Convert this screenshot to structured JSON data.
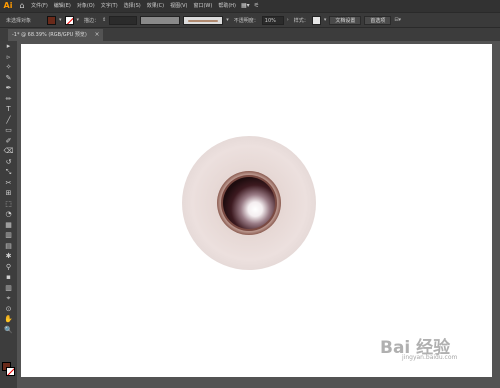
{
  "app": {
    "logo": "Ai",
    "home_icon": "home-icon"
  },
  "menu": [
    "文件(F)",
    "编辑(E)",
    "对象(O)",
    "文字(T)",
    "选择(S)",
    "效果(C)",
    "视图(V)",
    "窗口(W)",
    "帮助(H)"
  ],
  "menu_extra": {
    "workspace_glyph": "▦▾",
    "icon": "arrange-icon"
  },
  "control": {
    "no_selection": "未选择对象",
    "stroke_label": "描边：",
    "stroke_value": "",
    "opacity_label": "不透明度：",
    "opacity_value": "10%",
    "style_label": "样式：",
    "doc_setup": "文档设置",
    "preferences": "首选项",
    "fill_color": "#6a2a1a",
    "stroke_color": "none"
  },
  "tab": {
    "title": "@ 68.39% (RGB/GPU 预览)",
    "prefix": "-1*",
    "close": "×"
  },
  "tools": [
    "▸",
    "▹",
    "✧",
    "✎",
    "✒",
    "✏",
    "T",
    "╱",
    "▭",
    "✐",
    "⌫",
    "↺",
    "⤡",
    "✂",
    "⊞",
    "⬚",
    "◔",
    "▦",
    "▥",
    "▤",
    "✱",
    "⚲",
    "▪",
    "▥",
    "⌖",
    "⊙",
    "✋",
    "🔍"
  ],
  "watermark": {
    "text": "Bai 经验",
    "sub": "jingyan.baidu.com"
  },
  "colors": {
    "accent": "#ff9a00",
    "canvas": "#ffffff",
    "workspace": "#535353"
  }
}
